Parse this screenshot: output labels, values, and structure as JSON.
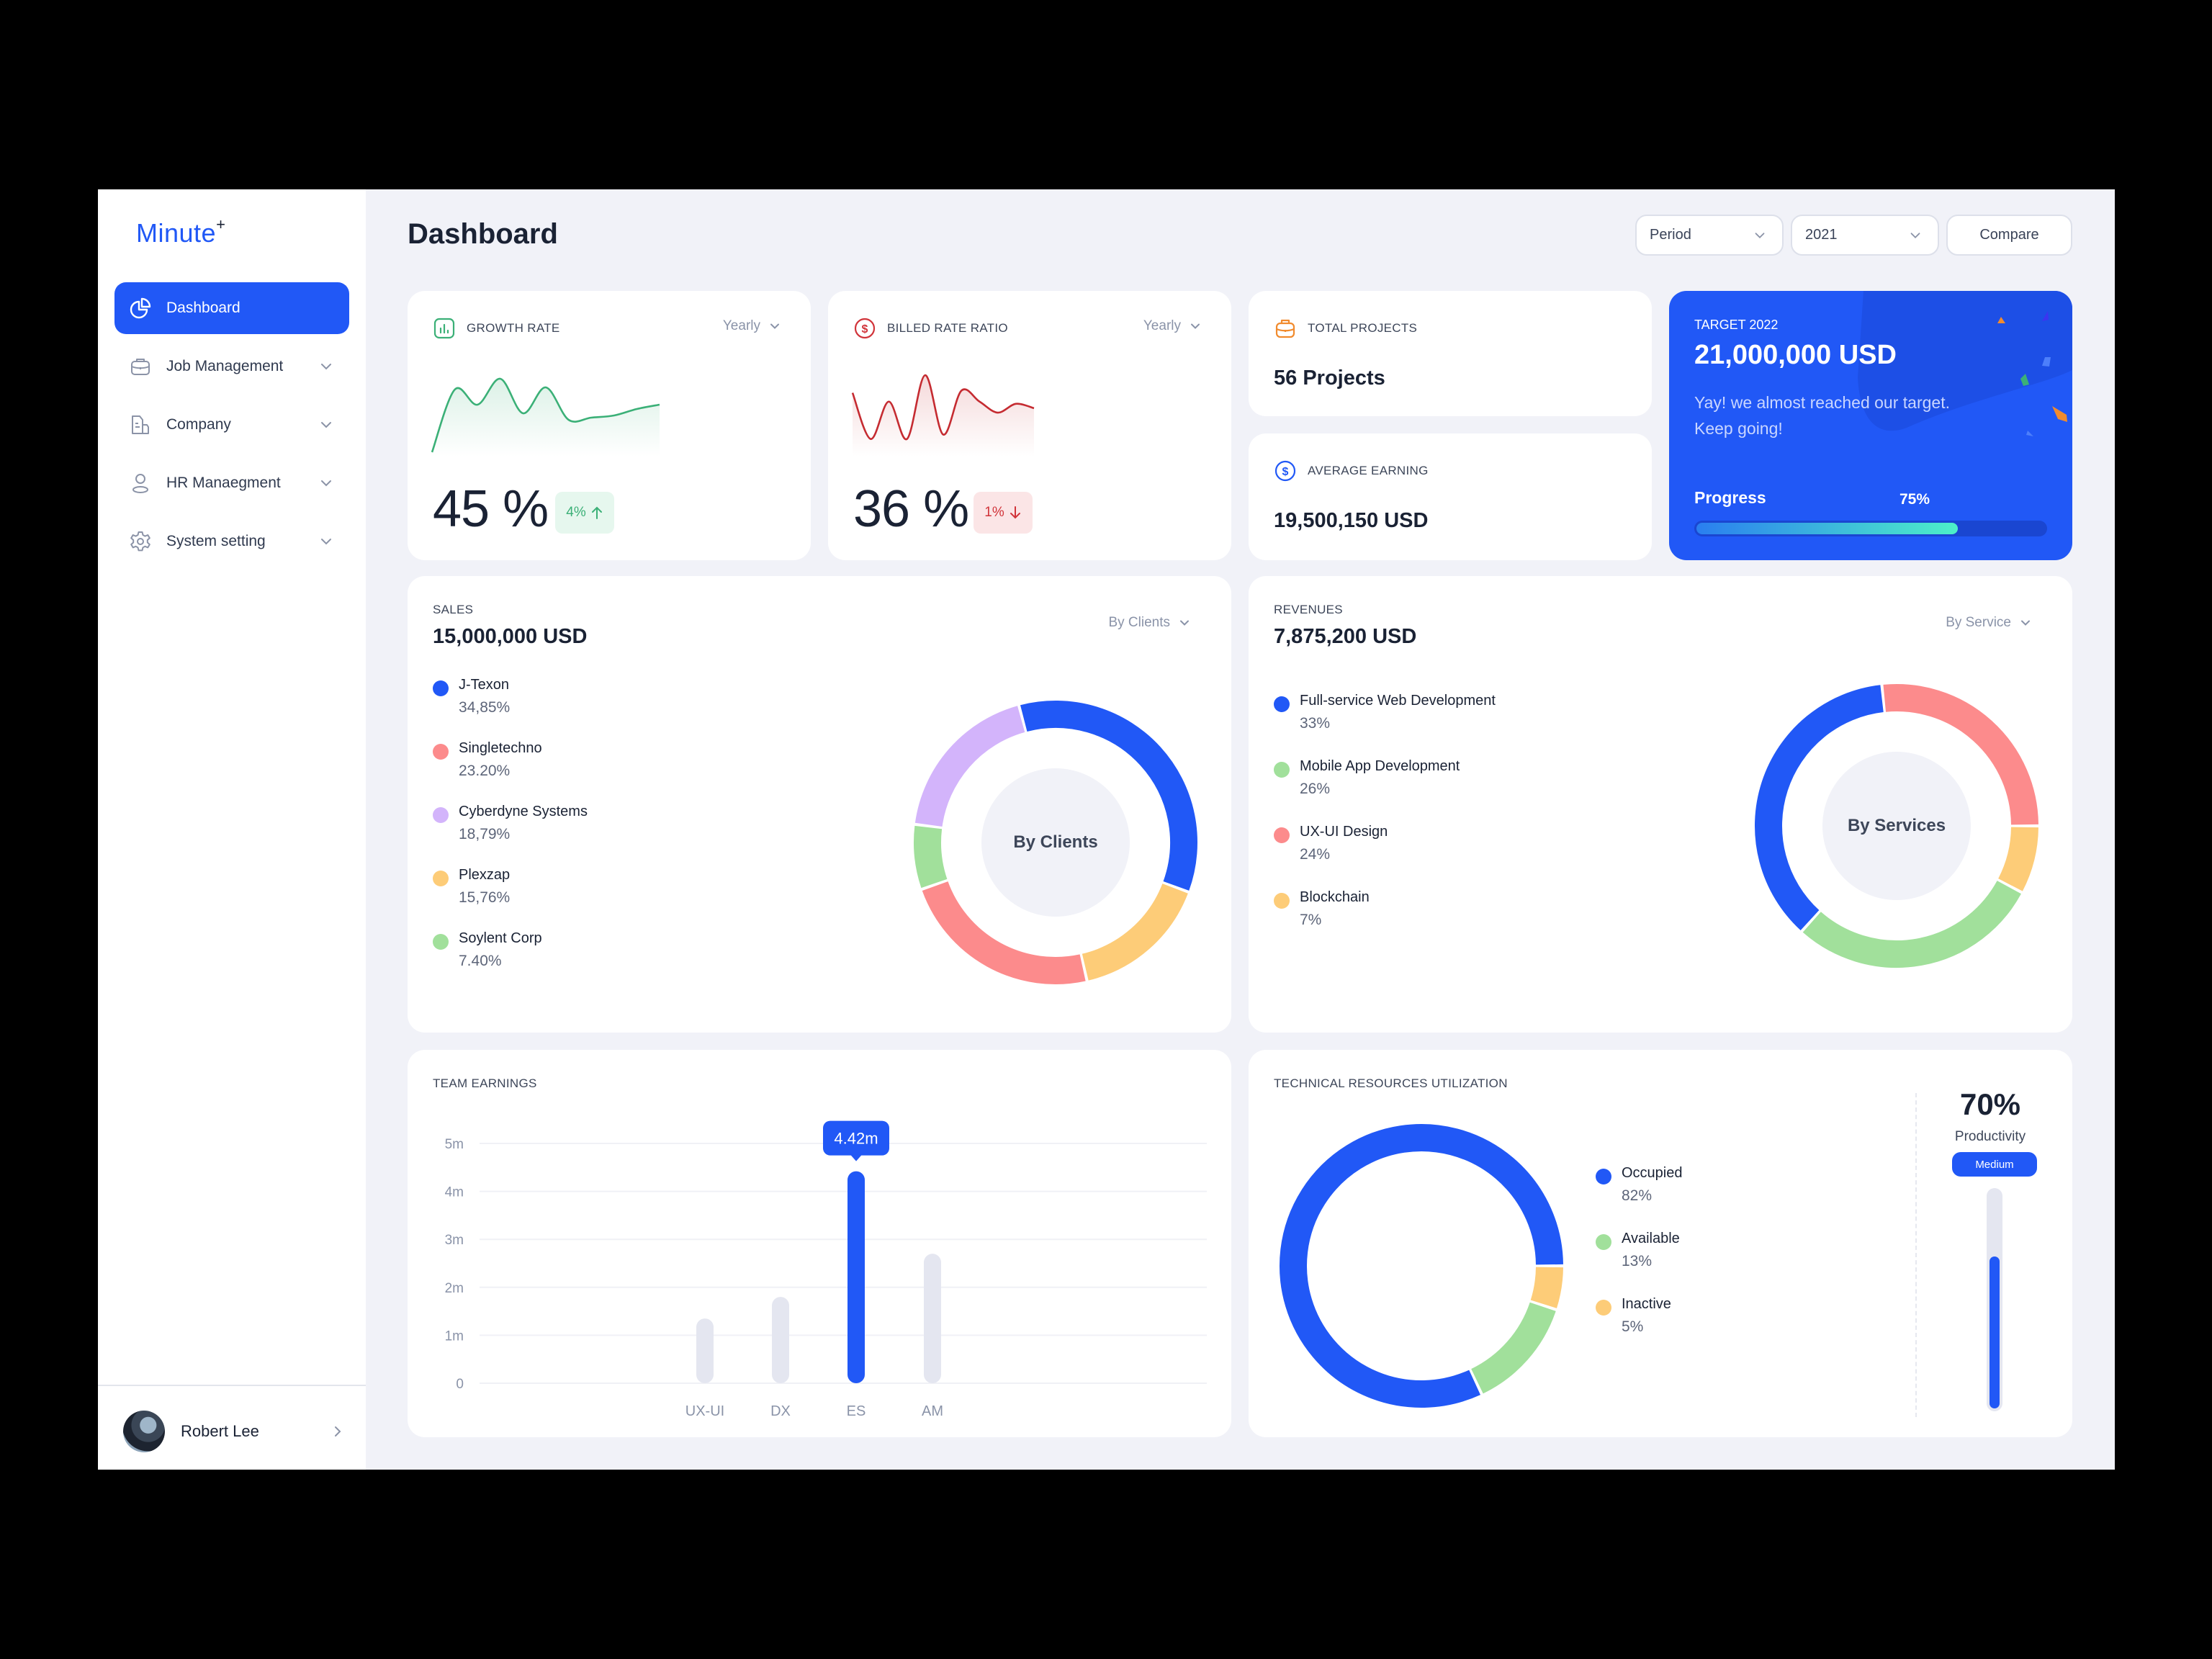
{
  "app": {
    "logo": "Minute",
    "logo_sup": "+"
  },
  "sidebar": {
    "items": [
      {
        "label": "Dashboard",
        "icon": "pie-chart-icon",
        "active": true
      },
      {
        "label": "Job Management",
        "icon": "briefcase-icon",
        "expandable": true
      },
      {
        "label": "Company",
        "icon": "building-icon",
        "expandable": true
      },
      {
        "label": "HR Manaegment",
        "icon": "user-icon",
        "expandable": true
      },
      {
        "label": "System setting",
        "icon": "gear-icon",
        "expandable": true
      }
    ],
    "user": {
      "name": "Robert Lee"
    }
  },
  "header": {
    "title": "Dashboard",
    "period_select": "Period",
    "year_select": "2021",
    "compare_label": "Compare"
  },
  "growth_rate": {
    "label": "GROWTH RATE",
    "period": "Yearly",
    "value": "45 %",
    "change": "4%",
    "direction": "up",
    "color": "#3bb077"
  },
  "billed_rate": {
    "label": "BILLED RATE RATIO",
    "period": "Yearly",
    "value": "36 %",
    "change": "1%",
    "direction": "down",
    "color": "#d1343a"
  },
  "total_projects": {
    "label": "TOTAL PROJECTS",
    "value": "56",
    "unit": "Projects"
  },
  "average_earning": {
    "label": "AVERAGE EARNING",
    "value": "19,500,150",
    "unit": "USD"
  },
  "target": {
    "label": "TARGET 2022",
    "value": "21,000,000 USD",
    "message_line1": "Yay! we almost reached our target.",
    "message_line2": "Keep going!",
    "progress_label": "Progress",
    "progress_text": "75%",
    "progress_value": 0.75
  },
  "sales": {
    "label": "SALES",
    "value": "15,000,000",
    "unit": "USD",
    "filter": "By Clients",
    "center_label": "By Clients"
  },
  "revenues": {
    "label": "REVENUES",
    "value": "7,875,200",
    "unit": "USD",
    "filter": "By Service",
    "center_label": "By Services"
  },
  "team_earnings": {
    "label": "TEAM EARNINGS",
    "tooltip": "4.42m"
  },
  "tech_resources": {
    "label": "TECHNICAL RESOURCES UTILIZATION",
    "productivity_value": "70%",
    "productivity_label": "Productivity",
    "productivity_level": "Medium",
    "productivity_fraction": 0.7
  },
  "chart_data": [
    {
      "type": "line",
      "title": "Growth Rate",
      "x": [
        0,
        1,
        2,
        3,
        4,
        5,
        6,
        7,
        8,
        9,
        10
      ],
      "values": [
        0,
        2.9,
        2.2,
        3.4,
        1.8,
        3.0,
        1.5,
        1.6,
        1.7,
        2.0,
        2.2
      ],
      "color": "#3bb077"
    },
    {
      "type": "line",
      "title": "Billed Rate Ratio",
      "x": [
        0,
        1,
        2,
        3,
        4,
        5,
        6,
        7,
        8,
        9,
        10
      ],
      "values": [
        2.7,
        0.6,
        2.3,
        0.6,
        3.5,
        0.8,
        2.8,
        2.3,
        1.8,
        2.2,
        2.0
      ],
      "color": "#c52b31"
    },
    {
      "type": "pie",
      "title": "Sales By Clients",
      "series": [
        {
          "name": "J-Texon",
          "value": 34.85,
          "label": "34,85%",
          "color": "#2158f6"
        },
        {
          "name": "Singletechno",
          "value": 23.2,
          "label": "23.20%",
          "color": "#fc8b8c"
        },
        {
          "name": "Cyberdyne Systems",
          "value": 18.79,
          "label": "18,79%",
          "color": "#d3b4fb"
        },
        {
          "name": "Plexzap",
          "value": 15.76,
          "label": "15,76%",
          "color": "#fdcc78"
        },
        {
          "name": "Soylent Corp",
          "value": 7.4,
          "label": "7.40%",
          "color": "#a1e09b"
        }
      ],
      "ring_order": [
        "J-Texon",
        "Plexzap",
        "Singletechno",
        "Soylent Corp",
        "Cyberdyne Systems"
      ]
    },
    {
      "type": "pie",
      "title": "Revenues By Service",
      "series": [
        {
          "name": "Full-service Web Development",
          "value": 33,
          "label": "33%",
          "color": "#2158f6"
        },
        {
          "name": "Mobile App Development",
          "value": 26,
          "label": "26%",
          "color": "#a1e09b"
        },
        {
          "name": "UX-UI Design",
          "value": 24,
          "label": "24%",
          "color": "#fc8b8c"
        },
        {
          "name": "Blockchain",
          "value": 7,
          "label": "7%",
          "color": "#fdcc78"
        }
      ],
      "ring_order": [
        "UX-UI Design",
        "Blockchain",
        "Mobile App Development",
        "Full-service Web Development"
      ]
    },
    {
      "type": "bar",
      "title": "TEAM EARNINGS",
      "categories": [
        "UX-UI",
        "DX",
        "ES",
        "AM"
      ],
      "values": [
        1.35,
        1.8,
        4.42,
        2.7
      ],
      "highlight": "ES",
      "yticks": [
        "0",
        "1m",
        "2m",
        "3m",
        "4m",
        "5m"
      ],
      "ylim": [
        0,
        5
      ],
      "unit": "m",
      "color": "#e4e6f0",
      "highlight_color": "#2158f6"
    },
    {
      "type": "pie",
      "title": "Technical Resources Utilization",
      "series": [
        {
          "name": "Occupied",
          "value": 82,
          "label": "82%",
          "color": "#2158f6"
        },
        {
          "name": "Available",
          "value": 13,
          "label": "13%",
          "color": "#a1e09b"
        },
        {
          "name": "Inactive",
          "value": 5,
          "label": "5%",
          "color": "#fdcc78"
        }
      ],
      "ring_order": [
        "Inactive",
        "Available",
        "Occupied"
      ]
    }
  ]
}
